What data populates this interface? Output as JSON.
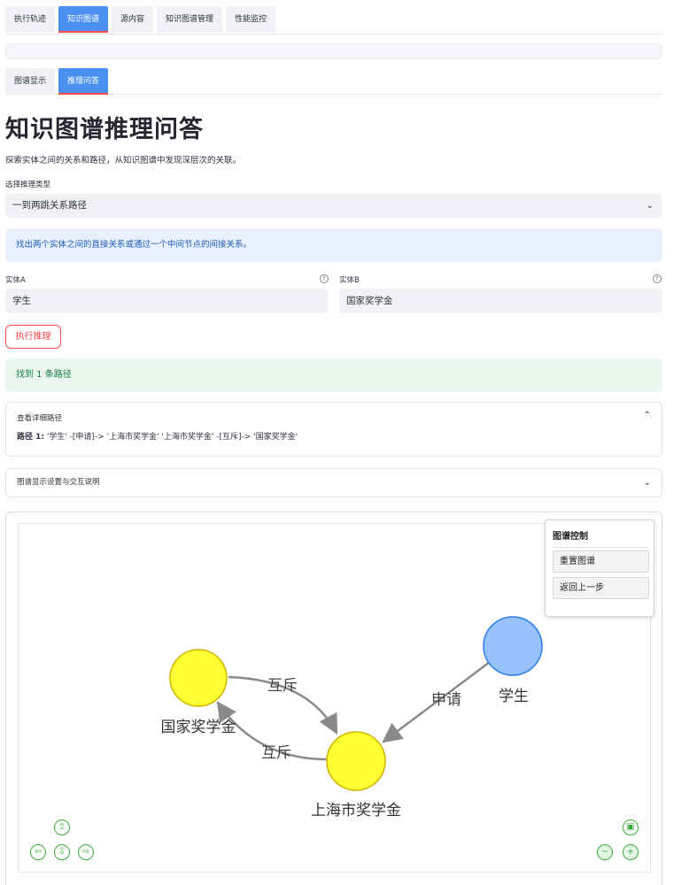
{
  "top_tabs": [
    {
      "label": "执行轨迹"
    },
    {
      "label": "知识图谱"
    },
    {
      "label": "源内容"
    },
    {
      "label": "知识图谱管理"
    },
    {
      "label": "性能监控"
    }
  ],
  "sub_tabs": [
    {
      "label": "图谱显示"
    },
    {
      "label": "推理问答"
    }
  ],
  "page": {
    "title": "知识图谱推理问答",
    "description": "探索实体之间的关系和路径，从知识图谱中发现深层次的关联。"
  },
  "reasoning": {
    "type_label": "选择推理类型",
    "type_value": "一到两跳关系路径",
    "info": "找出两个实体之间的直接关系或通过一个中间节点的间接关系。"
  },
  "entity_a": {
    "label": "实体A",
    "value": "学生",
    "help": "?"
  },
  "entity_b": {
    "label": "实体B",
    "value": "国家奖学金",
    "help": "?"
  },
  "run_button": "执行推理",
  "result": {
    "message": "找到 1 条路径"
  },
  "details": {
    "title": "查看详细路径",
    "path_prefix": "路径 1:",
    "path_text": " '学生' -[申请]-> '上海市奖学金' '上海市奖学金' -[互斥]-> '国家奖学金'"
  },
  "settings": {
    "title": "图谱显示设置与交互说明"
  },
  "graph": {
    "control_title": "图谱控制",
    "reset_button": "重置图谱",
    "back_button": "返回上一步",
    "nodes": [
      {
        "label": "学生",
        "color": "#97c2fc"
      },
      {
        "label": "国家奖学金",
        "color": "#ffff33"
      },
      {
        "label": "上海市奖学金",
        "color": "#ffff33"
      }
    ],
    "edges": [
      {
        "label": "申请"
      },
      {
        "label": "互斥"
      },
      {
        "label": "互斥"
      }
    ]
  },
  "colors": {
    "accent": "#4a90f2",
    "run_button": "#ff4b4b",
    "nav_icons": "#3aab3a"
  }
}
